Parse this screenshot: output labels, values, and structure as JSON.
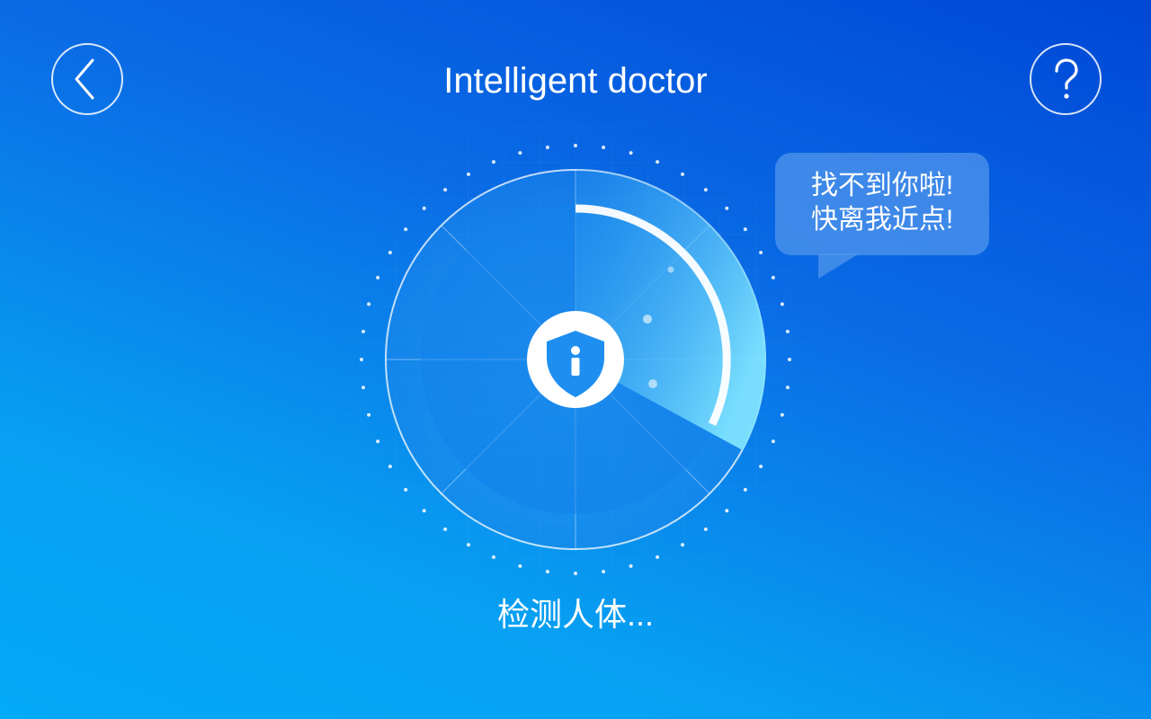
{
  "header": {
    "title": "Intelligent doctor",
    "back_icon": "chevron-left-icon",
    "help_icon": "question-mark-icon"
  },
  "radar": {
    "center_icon": "shield-person-icon",
    "accent_color": "#1e8ff0"
  },
  "bubble": {
    "line1": "找不到你啦!",
    "line2": "快离我近点!"
  },
  "status": {
    "text": "检测人体..."
  }
}
